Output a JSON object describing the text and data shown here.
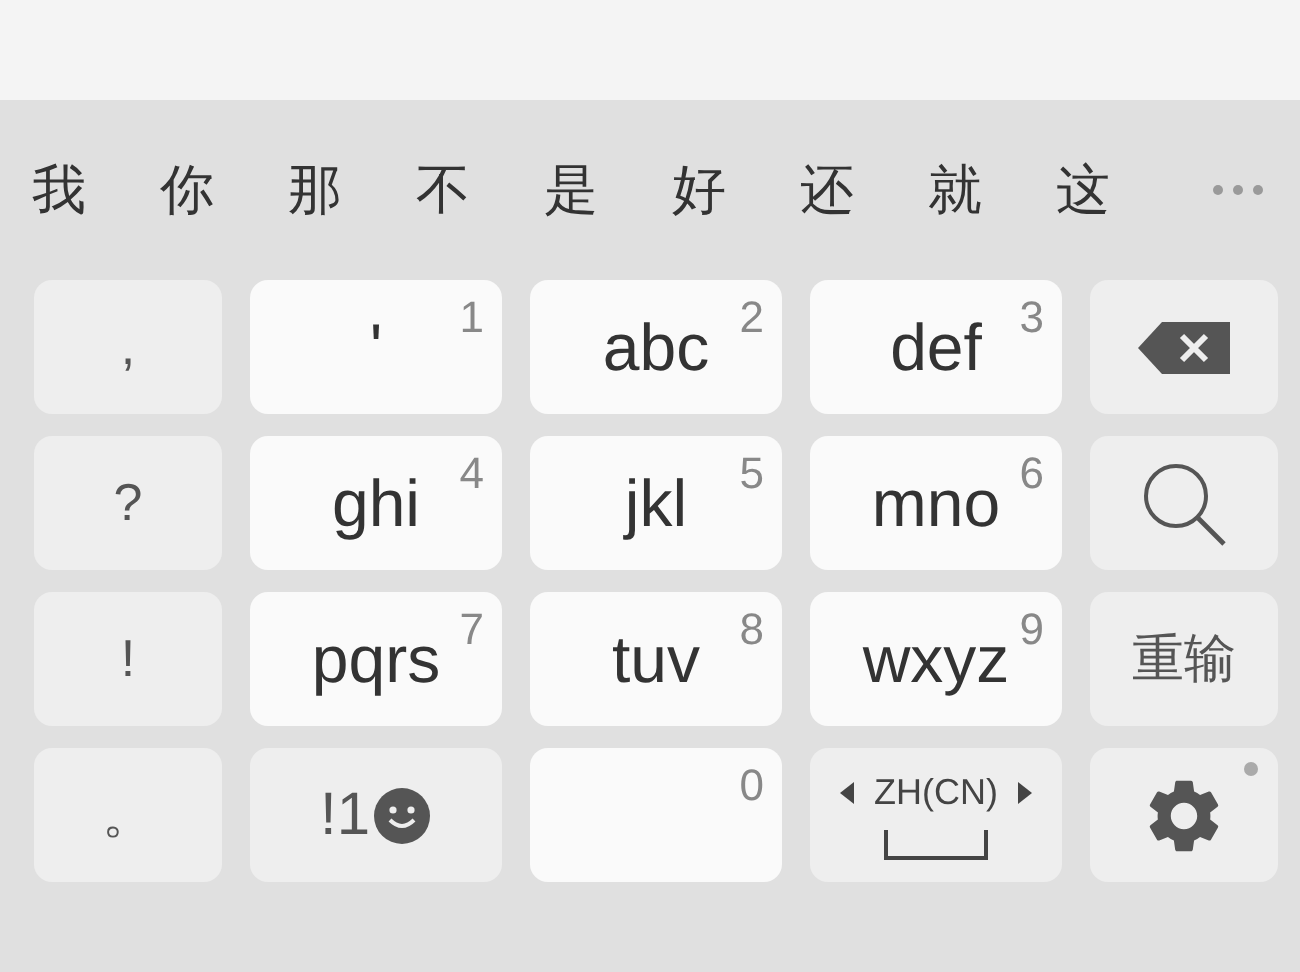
{
  "candidates": [
    "我",
    "你",
    "那",
    "不",
    "是",
    "好",
    "还",
    "就",
    "这"
  ],
  "keys": [
    {
      "kind": "symbol",
      "label": ","
    },
    {
      "kind": "letter",
      "label": "'",
      "digit": "1"
    },
    {
      "kind": "letter",
      "label": "abc",
      "digit": "2"
    },
    {
      "kind": "letter",
      "label": "def",
      "digit": "3"
    },
    {
      "kind": "backspace"
    },
    {
      "kind": "symbol",
      "label": "?"
    },
    {
      "kind": "letter",
      "label": "ghi",
      "digit": "4"
    },
    {
      "kind": "letter",
      "label": "jkl",
      "digit": "5"
    },
    {
      "kind": "letter",
      "label": "mno",
      "digit": "6"
    },
    {
      "kind": "search"
    },
    {
      "kind": "symbol",
      "label": "!"
    },
    {
      "kind": "letter",
      "label": "pqrs",
      "digit": "7"
    },
    {
      "kind": "letter",
      "label": "tuv",
      "digit": "8"
    },
    {
      "kind": "letter",
      "label": "wxyz",
      "digit": "9"
    },
    {
      "kind": "symbol",
      "label": "重输"
    },
    {
      "kind": "symbol",
      "label": "。"
    },
    {
      "kind": "emoji",
      "label": "!1"
    },
    {
      "kind": "space",
      "digit": "0"
    },
    {
      "kind": "language",
      "label": "ZH(CN)"
    },
    {
      "kind": "settings"
    }
  ]
}
